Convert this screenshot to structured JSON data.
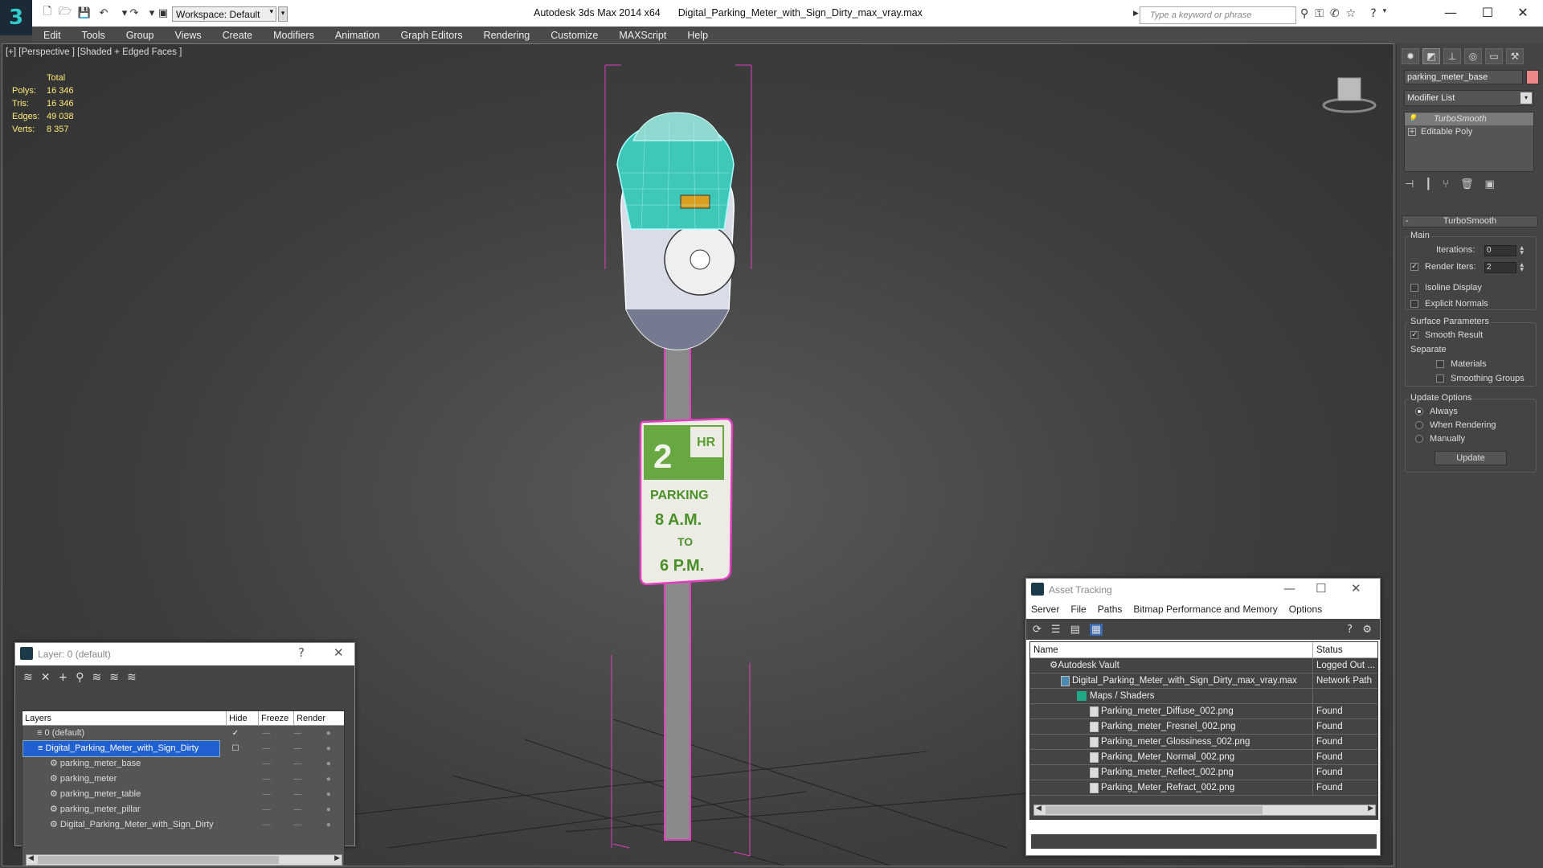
{
  "titlebar": {
    "app_name": "Autodesk 3ds Max  2014 x64",
    "file_name": "Digital_Parking_Meter_with_Sign_Dirty_max_vray.max",
    "workspace": "Workspace: Default",
    "search_placeholder": "Type a keyword or phrase",
    "minimize": "—",
    "maximize": "☐",
    "close": "✕"
  },
  "menu": [
    "Edit",
    "Tools",
    "Group",
    "Views",
    "Create",
    "Modifiers",
    "Animation",
    "Graph Editors",
    "Rendering",
    "Customize",
    "MAXScript",
    "Help"
  ],
  "viewport": {
    "label": "[+] [Perspective ] [Shaded + Edged Faces ]",
    "stats": {
      "header": "Total",
      "rows": [
        {
          "k": "Polys:",
          "v": "16 346"
        },
        {
          "k": "Tris:",
          "v": "16 346"
        },
        {
          "k": "Edges:",
          "v": "49 038"
        },
        {
          "k": "Verts:",
          "v": "8 357"
        }
      ]
    },
    "sign_text": {
      "num": "2",
      "hr": "HR",
      "l1": "PARKING",
      "l2": "8 A.M.",
      "l3": "TO",
      "l4": "6 P.M."
    },
    "colors": {
      "wire": "#40e0d0",
      "pink": "#e040c0",
      "sign_green": "#5aa030",
      "yellow": "#ffeb7a"
    }
  },
  "command_panel": {
    "object_name": "parking_meter_base",
    "modifier_list": "Modifier List",
    "stack": [
      {
        "label": "TurboSmooth",
        "selected": true
      },
      {
        "label": "Editable Poly",
        "selected": false
      }
    ],
    "rollout_title": "TurboSmooth",
    "main": {
      "group": "Main",
      "iterations_label": "Iterations:",
      "iterations": "0",
      "render_iters_label": "Render Iters:",
      "render_iters": "2",
      "isoline": "Isoline Display",
      "explicit": "Explicit Normals"
    },
    "surface": {
      "group": "Surface Parameters",
      "smooth": "Smooth Result",
      "separate": "Separate",
      "materials": "Materials",
      "smoothing": "Smoothing Groups"
    },
    "update": {
      "group": "Update Options",
      "always": "Always",
      "when": "When Rendering",
      "manually": "Manually",
      "button": "Update"
    }
  },
  "layer_dialog": {
    "title": "Layer: 0 (default)",
    "help": "?",
    "close": "✕",
    "columns": [
      "Layers",
      "Hide",
      "Freeze",
      "Render"
    ],
    "rows": [
      {
        "name": "0 (default)",
        "indent": 1,
        "icon": "layer",
        "selected": false,
        "mark": "✓"
      },
      {
        "name": "Digital_Parking_Meter_with_Sign_Dirty",
        "indent": 1,
        "icon": "layer",
        "selected": true,
        "mark": "☐"
      },
      {
        "name": "parking_meter_base",
        "indent": 2,
        "icon": "object",
        "selected": false,
        "mark": ""
      },
      {
        "name": "parking_meter",
        "indent": 2,
        "icon": "object",
        "selected": false,
        "mark": ""
      },
      {
        "name": "parking_meter_table",
        "indent": 2,
        "icon": "object",
        "selected": false,
        "mark": ""
      },
      {
        "name": "parking_meter_pillar",
        "indent": 2,
        "icon": "object",
        "selected": false,
        "mark": ""
      },
      {
        "name": "Digital_Parking_Meter_with_Sign_Dirty",
        "indent": 2,
        "icon": "object",
        "selected": false,
        "mark": ""
      }
    ]
  },
  "asset_dialog": {
    "title": "Asset Tracking",
    "menu": [
      "Server",
      "File",
      "Paths",
      "Bitmap Performance and Memory",
      "Options"
    ],
    "columns": [
      "Name",
      "Status"
    ],
    "rows": [
      {
        "name": "Autodesk Vault",
        "status": "Logged Out ...",
        "indent": 1,
        "icon": "vault"
      },
      {
        "name": "Digital_Parking_Meter_with_Sign_Dirty_max_vray.max",
        "status": "Network Path",
        "indent": 2,
        "icon": "max"
      },
      {
        "name": "Maps / Shaders",
        "status": "",
        "indent": 3,
        "icon": "maps"
      },
      {
        "name": "Parking_meter_Diffuse_002.png",
        "status": "Found",
        "indent": 4,
        "icon": "file"
      },
      {
        "name": "Parking_meter_Fresnel_002.png",
        "status": "Found",
        "indent": 4,
        "icon": "file"
      },
      {
        "name": "Parking_meter_Glossiness_002.png",
        "status": "Found",
        "indent": 4,
        "icon": "file"
      },
      {
        "name": "Parking_Meter_Normal_002.png",
        "status": "Found",
        "indent": 4,
        "icon": "file"
      },
      {
        "name": "Parking_meter_Reflect_002.png",
        "status": "Found",
        "indent": 4,
        "icon": "file"
      },
      {
        "name": "Parking_Meter_Refract_002.png",
        "status": "Found",
        "indent": 4,
        "icon": "file"
      }
    ]
  }
}
